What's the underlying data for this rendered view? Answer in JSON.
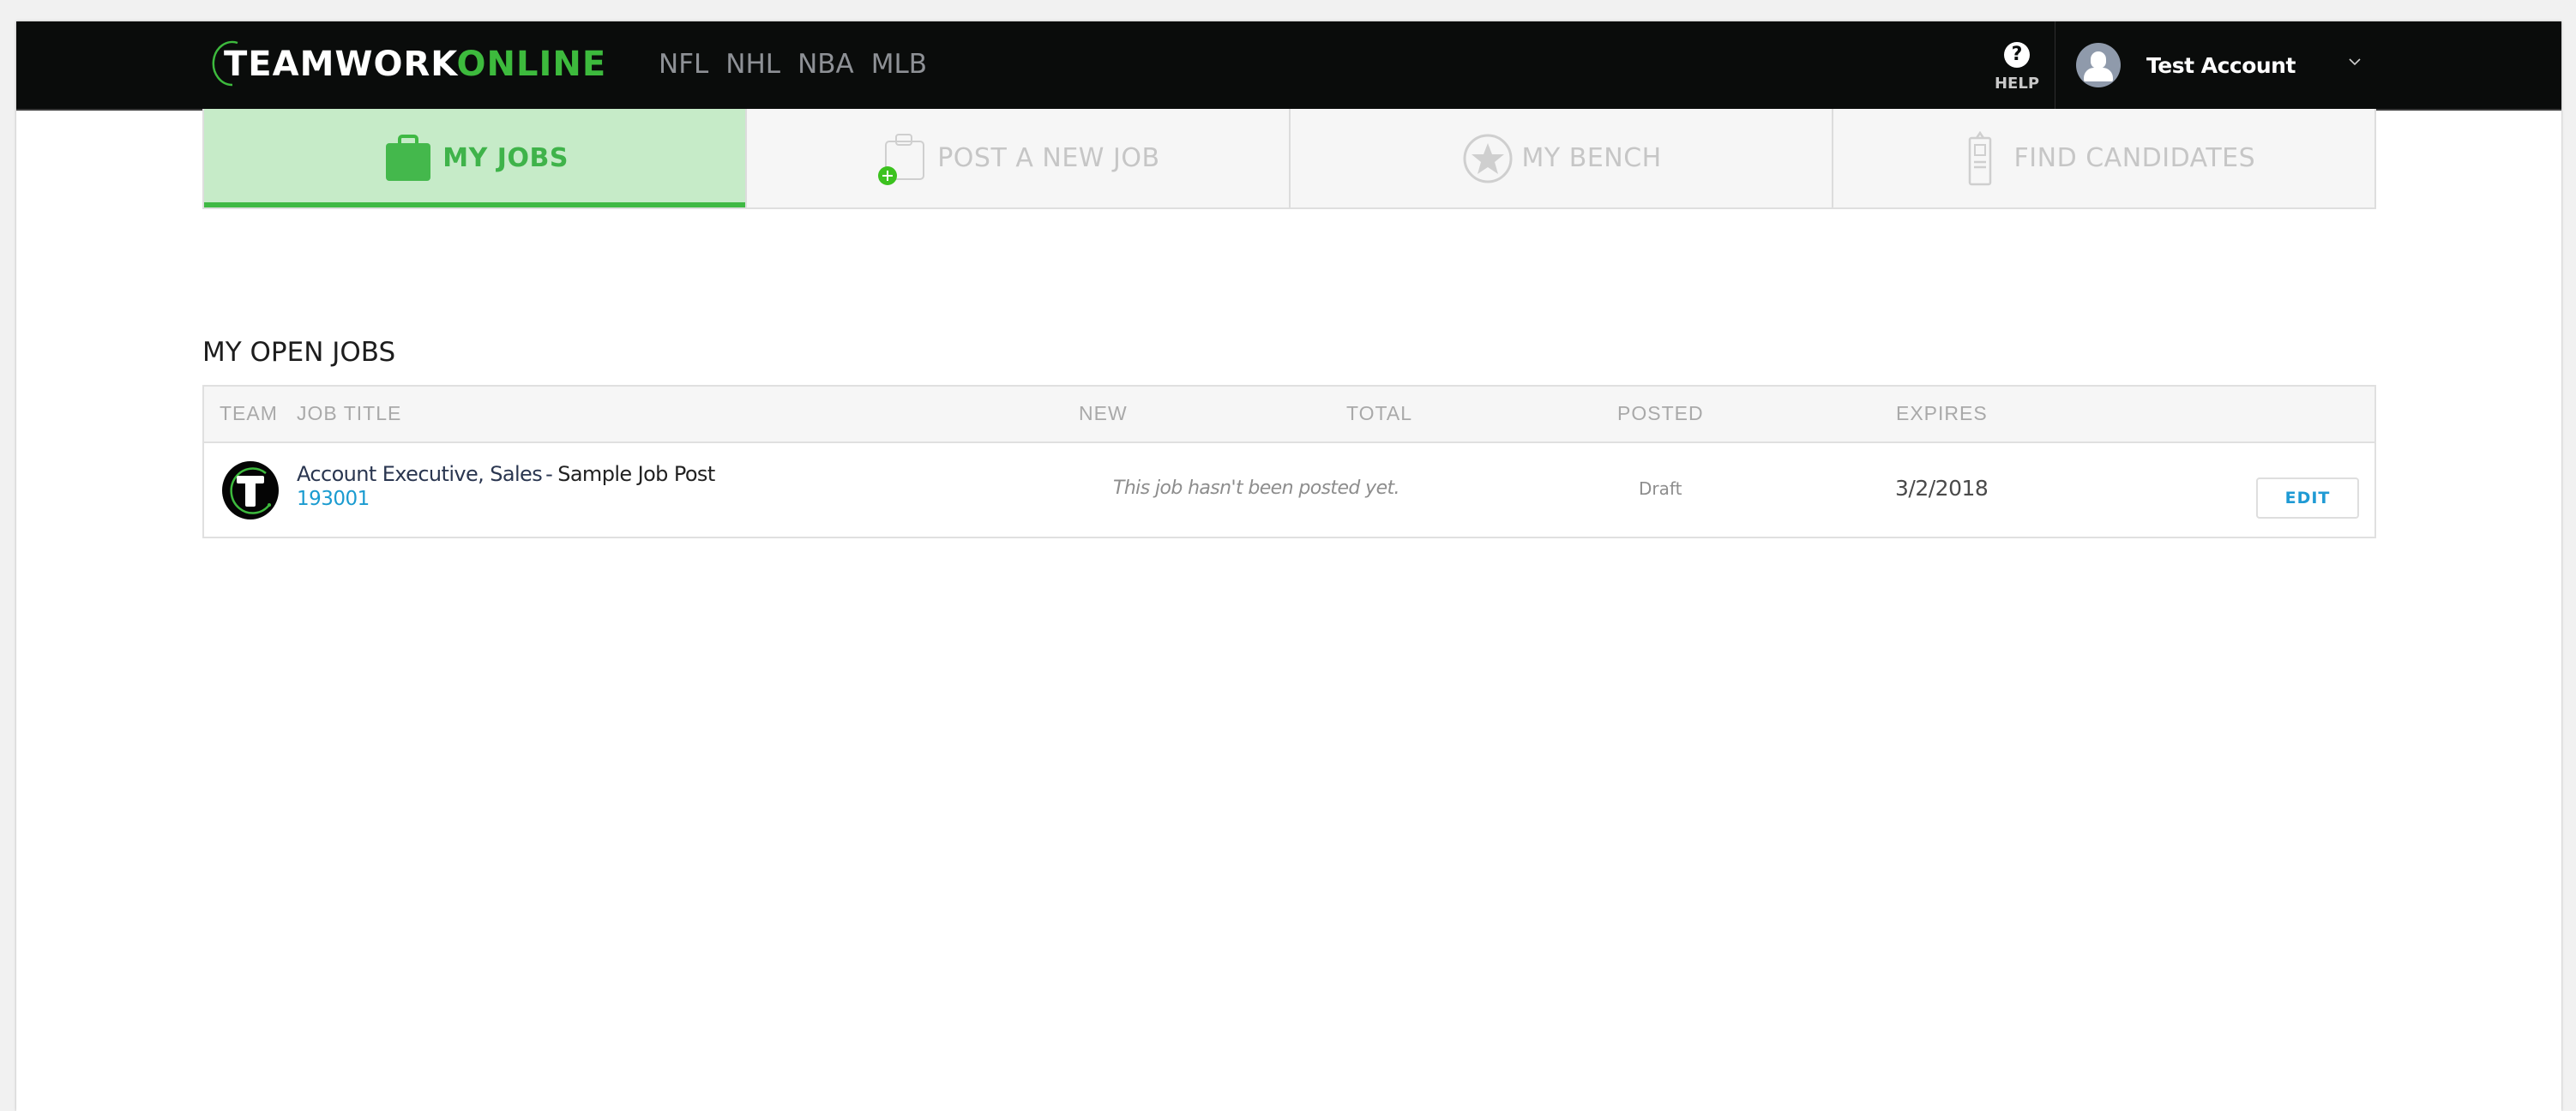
{
  "header": {
    "logo": {
      "part1": "TEAMWORK",
      "part2": "ONLINE"
    },
    "leagues": [
      "NFL",
      "NHL",
      "NBA",
      "MLB"
    ],
    "help": {
      "icon": "question-circle-icon",
      "label": "HELP"
    },
    "user": {
      "name": "Test Account",
      "avatar_icon": "user-silhouette-icon",
      "menu_icon": "chevron-down-icon"
    }
  },
  "tabs": [
    {
      "label": "MY JOBS",
      "icon": "briefcase-icon",
      "active": true
    },
    {
      "label": "POST A NEW JOB",
      "icon": "briefcase-plus-icon",
      "active": false
    },
    {
      "label": "MY BENCH",
      "icon": "star-circle-icon",
      "active": false
    },
    {
      "label": "FIND CANDIDATES",
      "icon": "id-badge-icon",
      "active": false
    }
  ],
  "section": {
    "title": "MY OPEN JOBS"
  },
  "table": {
    "columns": [
      "TEAM",
      "JOB TITLE",
      "NEW",
      "TOTAL",
      "POSTED",
      "EXPIRES"
    ],
    "rows": [
      {
        "team_logo": "teamwork-t-logo",
        "job_title": "Account Executive, Sales",
        "separator": "-",
        "company": "Sample Job Post",
        "job_id": "193001",
        "new_total_note": "This job hasn't been posted yet.",
        "posted": "Draft",
        "expires": "3/2/2018",
        "action_label": "EDIT"
      }
    ]
  },
  "colors": {
    "brand_green": "#3dba3d",
    "active_tab_bg": "#c6ebc8",
    "nav_bg": "#0a0c0b",
    "link_blue": "#1a9bd0"
  }
}
